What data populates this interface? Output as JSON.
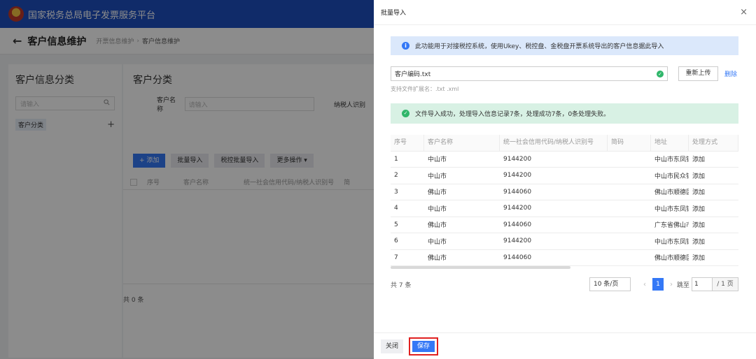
{
  "app": {
    "title": "国家税务总局电子发票服务平台"
  },
  "crumbbar": {
    "back": "←",
    "title": "客户信息维护",
    "crumb1": "开票信息维护",
    "sep": "›",
    "crumb2": "客户信息维护"
  },
  "left_panel": {
    "title": "客户信息分类",
    "search_placeholder": "请输入",
    "tree_node": "客户分类",
    "add": "+"
  },
  "main_panel": {
    "title": "客户分类",
    "filter_label": "客户名称",
    "filter_placeholder": "请输入",
    "filter_label2": "纳税人识别",
    "buttons": {
      "add": "+ 添加",
      "batch_import": "批量导入",
      "tax_batch_import": "税控批量导入",
      "more": "更多操作 ▾"
    },
    "headers": {
      "no": "序号",
      "name": "客户名称",
      "code": "统一社会信用代码/纳税人识别号",
      "extra": "简"
    },
    "total": "共 0 条"
  },
  "drawer": {
    "title": "批量导入",
    "close": "×",
    "info": "此功能用于对接税控系统，使用Ukey、税控盘、金税盘开票系统导出的客户信息据此导入",
    "file_name": "客户编码.txt",
    "reupload": "重新上传",
    "delete": "删除",
    "ext_hint": "支持文件扩展名：.txt .xml",
    "success": "文件导入成功，处理导入信息记录7条，处理成功7条，0条处理失败。",
    "columns": [
      "序号",
      "客户名称",
      "统一社会信用代码/纳税人识别号",
      "简码",
      "地址",
      "处理方式"
    ],
    "rows": [
      [
        "1",
        "中山市",
        "9144200",
        "",
        "中山市东凤镇",
        "添加"
      ],
      [
        "2",
        "中山市",
        "9144200",
        "",
        "中山市民众镇",
        "添加"
      ],
      [
        "3",
        "佛山市",
        "9144060",
        "",
        "佛山市顺德区",
        "添加"
      ],
      [
        "4",
        "中山市",
        "9144200",
        "",
        "中山市东凤镇",
        "添加"
      ],
      [
        "5",
        "佛山市",
        "9144060",
        "",
        "广东省佛山市",
        "添加"
      ],
      [
        "6",
        "中山市",
        "9144200",
        "",
        "中山市东凤镇",
        "添加"
      ],
      [
        "7",
        "佛山市",
        "9144060",
        "",
        "佛山市顺德区",
        "添加"
      ]
    ],
    "pager": {
      "total": "共 7 条",
      "page_size": "10 条/页",
      "prev": "‹",
      "page": "1",
      "next": "›",
      "jump_label": "跳至",
      "jump_value": "1",
      "pages_total": "/ 1 页"
    },
    "footer": {
      "close": "关闭",
      "save": "保存"
    }
  },
  "colors": {
    "primary": "#3478f6",
    "success": "#2fb66a",
    "topbar": "#1e4fbf",
    "highlight": "#e02020"
  }
}
